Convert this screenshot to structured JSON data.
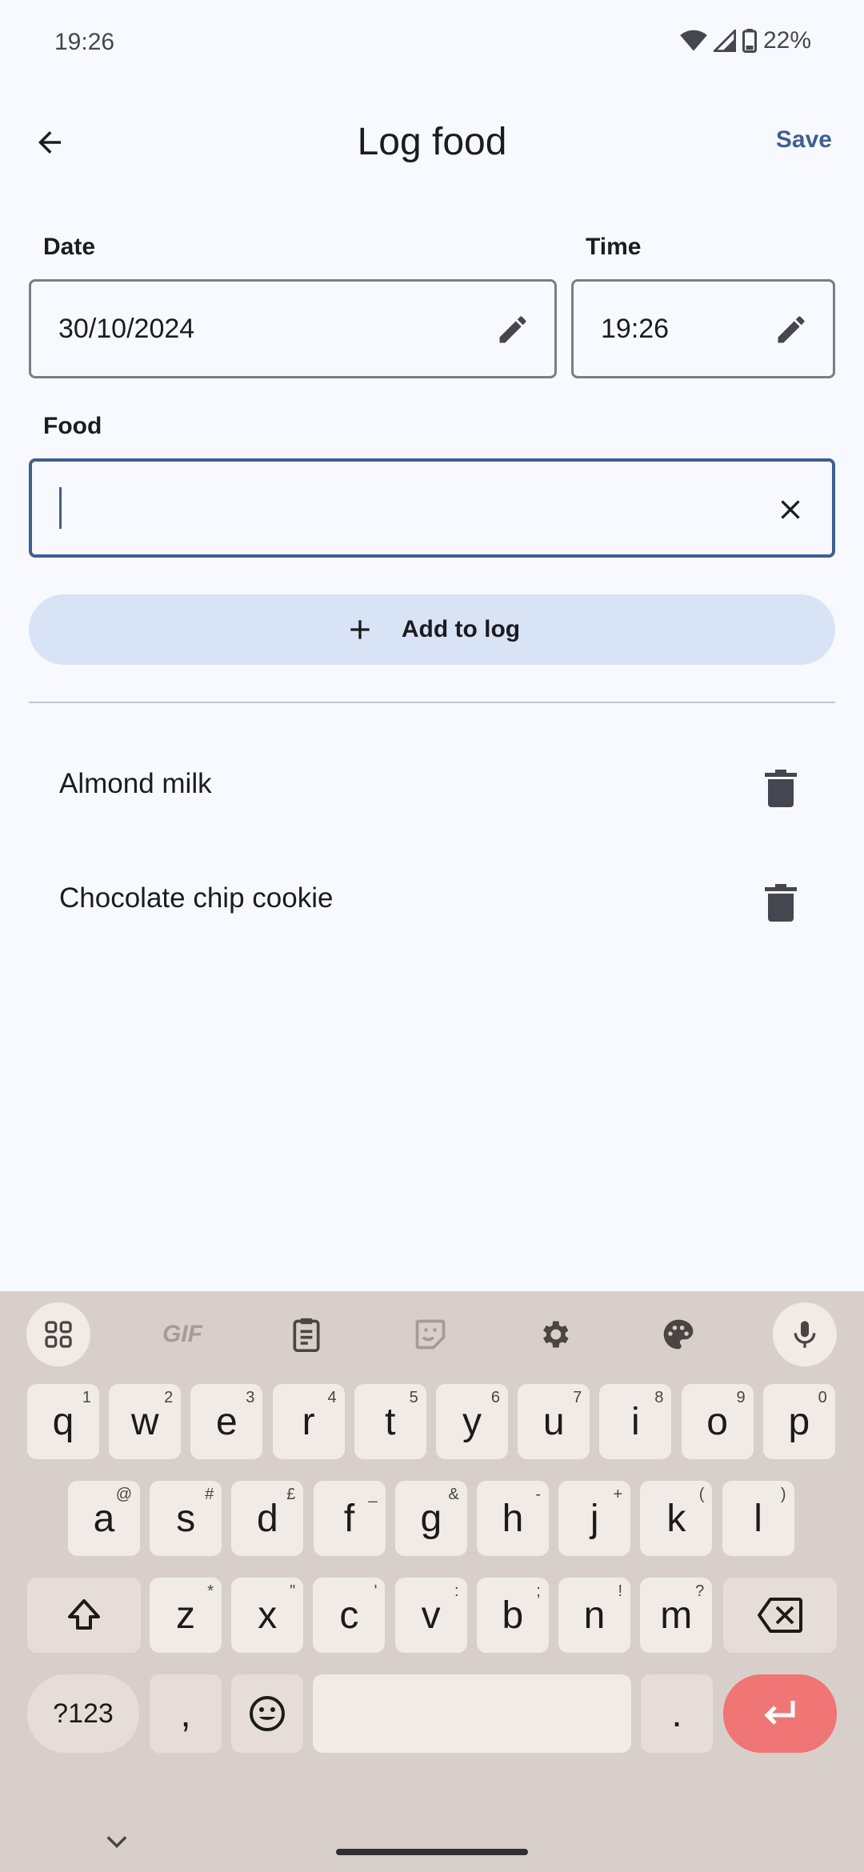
{
  "status_bar": {
    "time": "19:26",
    "battery": "22%"
  },
  "app_bar": {
    "title": "Log food",
    "save_label": "Save"
  },
  "form": {
    "date_label": "Date",
    "date_value": "30/10/2024",
    "time_label": "Time",
    "time_value": "19:26",
    "food_label": "Food",
    "food_value": ""
  },
  "add_button": {
    "label": "Add to log"
  },
  "log_items": [
    {
      "name": "Almond milk"
    },
    {
      "name": "Chocolate chip cookie"
    }
  ],
  "keyboard": {
    "toolbar": [
      "grid-icon",
      "gif-icon",
      "clipboard-icon",
      "sticker-icon",
      "gear-icon",
      "palette-icon",
      "mic-icon"
    ],
    "gif_label": "GIF",
    "row1": [
      {
        "k": "q",
        "s": "1"
      },
      {
        "k": "w",
        "s": "2"
      },
      {
        "k": "e",
        "s": "3"
      },
      {
        "k": "r",
        "s": "4"
      },
      {
        "k": "t",
        "s": "5"
      },
      {
        "k": "y",
        "s": "6"
      },
      {
        "k": "u",
        "s": "7"
      },
      {
        "k": "i",
        "s": "8"
      },
      {
        "k": "o",
        "s": "9"
      },
      {
        "k": "p",
        "s": "0"
      }
    ],
    "row2": [
      {
        "k": "a",
        "s": "@"
      },
      {
        "k": "s",
        "s": "#"
      },
      {
        "k": "d",
        "s": "£"
      },
      {
        "k": "f",
        "s": "_"
      },
      {
        "k": "g",
        "s": "&"
      },
      {
        "k": "h",
        "s": "-"
      },
      {
        "k": "j",
        "s": "+"
      },
      {
        "k": "k",
        "s": "("
      },
      {
        "k": "l",
        "s": ")"
      }
    ],
    "row3": [
      {
        "k": "z",
        "s": "*"
      },
      {
        "k": "x",
        "s": "\""
      },
      {
        "k": "c",
        "s": "'"
      },
      {
        "k": "v",
        "s": ":"
      },
      {
        "k": "b",
        "s": ";"
      },
      {
        "k": "n",
        "s": "!"
      },
      {
        "k": "m",
        "s": "?"
      }
    ],
    "symbols_label": "?123",
    "comma_label": ",",
    "period_label": "."
  }
}
